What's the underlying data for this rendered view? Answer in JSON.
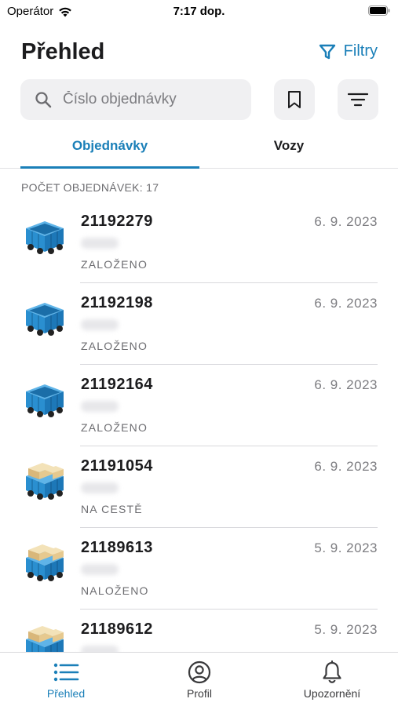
{
  "status_bar": {
    "carrier": "Operátor",
    "time": "7:17 dop."
  },
  "header": {
    "title": "Přehled",
    "filter_label": "Filtry"
  },
  "search": {
    "placeholder": "Číslo objednávky",
    "value": ""
  },
  "tabs": [
    {
      "label": "Objednávky",
      "active": true
    },
    {
      "label": "Vozy",
      "active": false
    }
  ],
  "order_count_label": "POČET OBJEDNÁVEK: 17",
  "orders": [
    {
      "number": "21192279",
      "date": "6. 9. 2023",
      "status": "ZALOŽENO",
      "icon": "empty-wagon-icon"
    },
    {
      "number": "21192198",
      "date": "6. 9. 2023",
      "status": "ZALOŽENO",
      "icon": "empty-wagon-icon"
    },
    {
      "number": "21192164",
      "date": "6. 9. 2023",
      "status": "ZALOŽENO",
      "icon": "empty-wagon-icon"
    },
    {
      "number": "21191054",
      "date": "6. 9. 2023",
      "status": "NA CESTĚ",
      "icon": "loaded-wagon-icon"
    },
    {
      "number": "21189613",
      "date": "5. 9. 2023",
      "status": "NALOŽENO",
      "icon": "loaded-wagon-icon"
    },
    {
      "number": "21189612",
      "date": "5. 9. 2023",
      "status": "",
      "icon": "loaded-wagon-icon"
    }
  ],
  "bottom_nav": {
    "overview": "Přehled",
    "profile": "Profil",
    "alerts": "Upozornění"
  },
  "colors": {
    "accent": "#1a7fb8",
    "wagon_blue": "#2a8fd0",
    "cargo_tan": "#e6c98f"
  }
}
